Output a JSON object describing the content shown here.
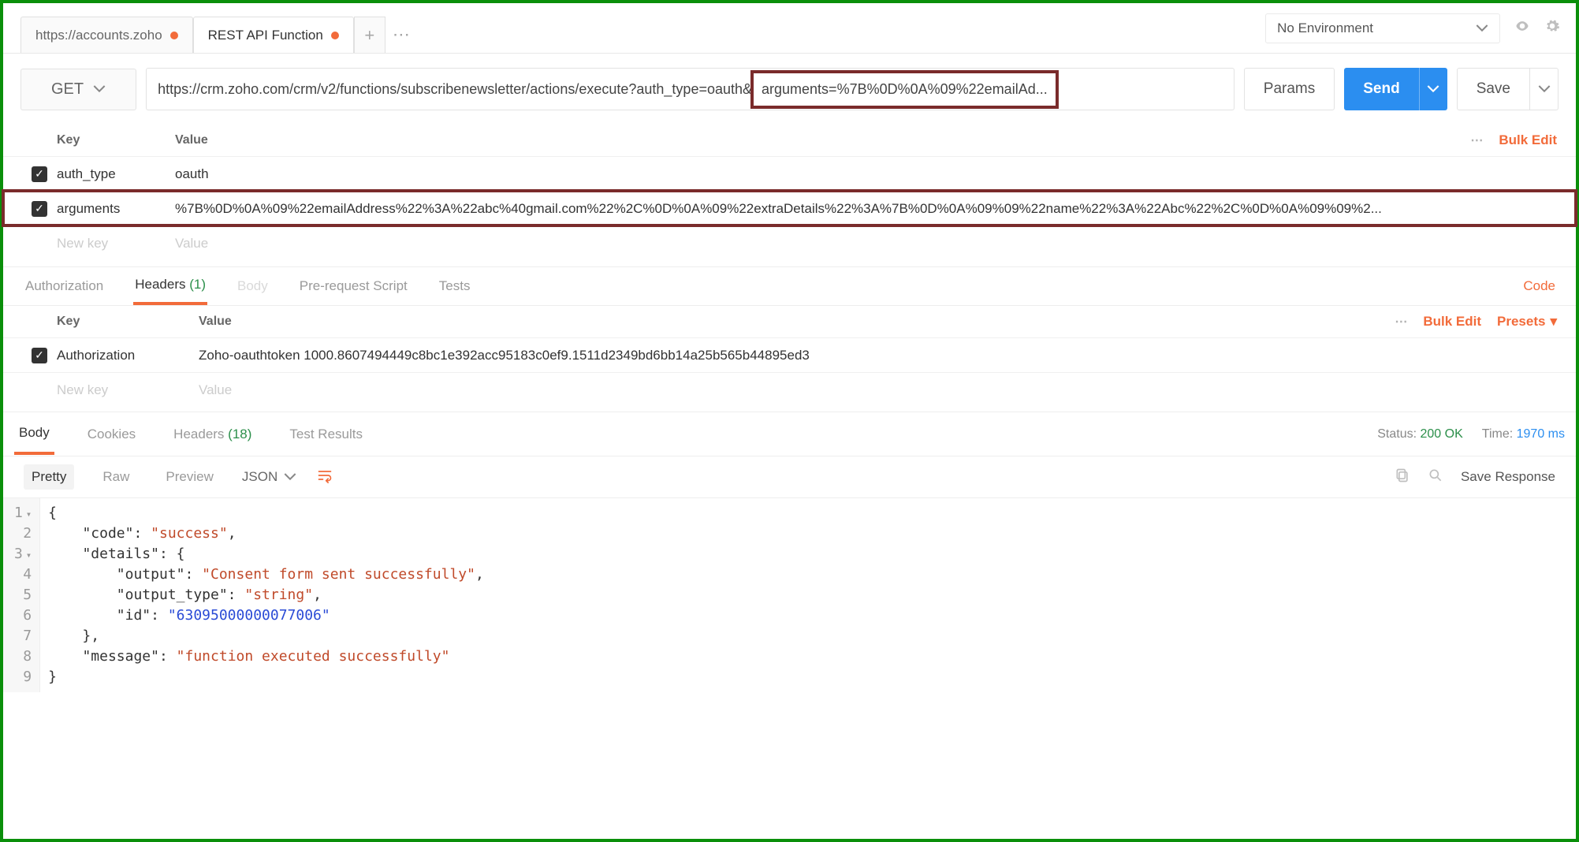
{
  "topbar": {
    "tabs": [
      {
        "label": "https://accounts.zoho",
        "dirty": true,
        "active": false
      },
      {
        "label": "REST API Function",
        "dirty": true,
        "active": true
      }
    ],
    "environment": "No Environment"
  },
  "request": {
    "method": "GET",
    "url_prefix": "https://crm.zoho.com/crm/v2/functions/subscribenewsletter/actions/execute?auth_type=oauth&",
    "url_highlight": "arguments=%7B%0D%0A%09%22emailAd...",
    "params_label": "Params",
    "send_label": "Send",
    "save_label": "Save"
  },
  "params": {
    "key_header": "Key",
    "value_header": "Value",
    "bulk_edit": "Bulk Edit",
    "rows": [
      {
        "checked": true,
        "key": "auth_type",
        "value": "oauth",
        "highlight": false
      },
      {
        "checked": true,
        "key": "arguments",
        "value": "%7B%0D%0A%09%22emailAddress%22%3A%22abc%40gmail.com%22%2C%0D%0A%09%22extraDetails%22%3A%7B%0D%0A%09%09%22name%22%3A%22Abc%22%2C%0D%0A%09%09%2...",
        "highlight": true
      }
    ],
    "new_key": "New key",
    "new_value": "Value"
  },
  "inner_tabs": {
    "authorization": "Authorization",
    "headers": "Headers",
    "headers_count": "(1)",
    "body": "Body",
    "prerequest": "Pre-request Script",
    "tests": "Tests",
    "code": "Code"
  },
  "headers": {
    "key_header": "Key",
    "value_header": "Value",
    "bulk_edit": "Bulk Edit",
    "presets": "Presets",
    "rows": [
      {
        "checked": true,
        "key": "Authorization",
        "value": "Zoho-oauthtoken 1000.8607494449c8bc1e392acc95183c0ef9.1511d2349bd6bb14a25b565b44895ed3"
      }
    ],
    "new_key": "New key",
    "new_value": "Value"
  },
  "response": {
    "tabs": {
      "body": "Body",
      "cookies": "Cookies",
      "headers": "Headers",
      "headers_count": "(18)",
      "test_results": "Test Results"
    },
    "status_label": "Status:",
    "status_value": "200 OK",
    "time_label": "Time:",
    "time_value": "1970 ms",
    "view_modes": {
      "pretty": "Pretty",
      "raw": "Raw",
      "preview": "Preview"
    },
    "format": "JSON",
    "save_response": "Save Response",
    "json_lines": {
      "l1": "{",
      "l2_key": "\"code\"",
      "l2_val": "\"success\"",
      "l3_key": "\"details\"",
      "l4_key": "\"output\"",
      "l4_val": "\"Consent form sent successfully\"",
      "l5_key": "\"output_type\"",
      "l5_val": "\"string\"",
      "l6_key": "\"id\"",
      "l6_val": "\"63095000000077006\"",
      "l8_key": "\"message\"",
      "l8_val": "\"function executed successfully\""
    }
  }
}
